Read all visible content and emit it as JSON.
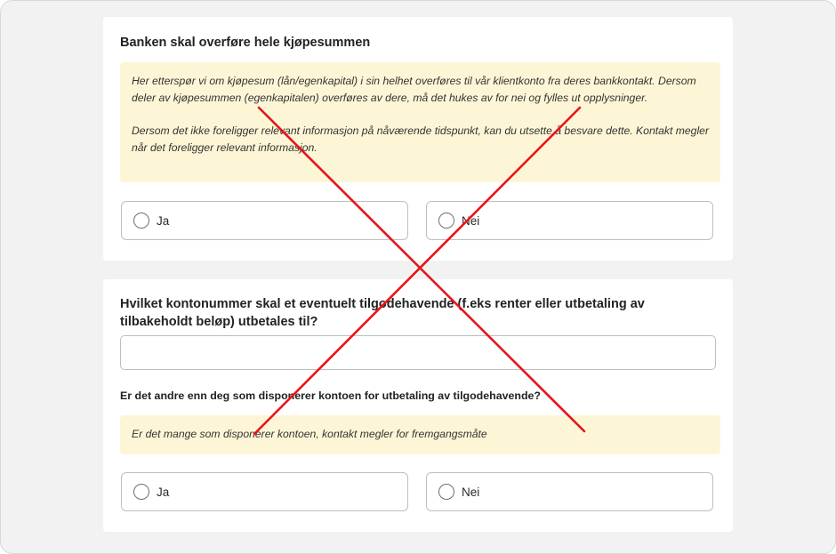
{
  "section1": {
    "title": "Banken skal overføre hele kjøpesummen",
    "info_paragraph_1": "Her etterspør vi om kjøpesum (lån/egenkapital) i sin helhet overføres til vår klientkonto fra deres bankkontakt. Dersom deler av kjøpesummen (egenkapitalen) overføres av dere, må det hukes av for nei og fylles ut opplysninger.",
    "info_paragraph_2": "Dersom det ikke foreligger relevant informasjon på nåværende tidspunkt, kan du utsette å besvare dette. Kontakt megler når det foreligger relevant informasjon.",
    "option_yes": "Ja",
    "option_no": "Nei"
  },
  "section2": {
    "title": "Hvilket kontonummer skal et eventuelt tilgodehavende (f.eks renter eller utbetaling av tilbakeholdt beløp) utbetales til?",
    "account_input_value": "",
    "sub_question": "Er det andre enn deg som disponerer kontoen for utbetaling av tilgodehavende?",
    "info_text": "Er det mange som disponerer kontoen, kontakt megler for fremgangsmåte",
    "option_yes": "Ja",
    "option_no": "Nei"
  },
  "overlay": {
    "cross_color": "#e8141b"
  }
}
